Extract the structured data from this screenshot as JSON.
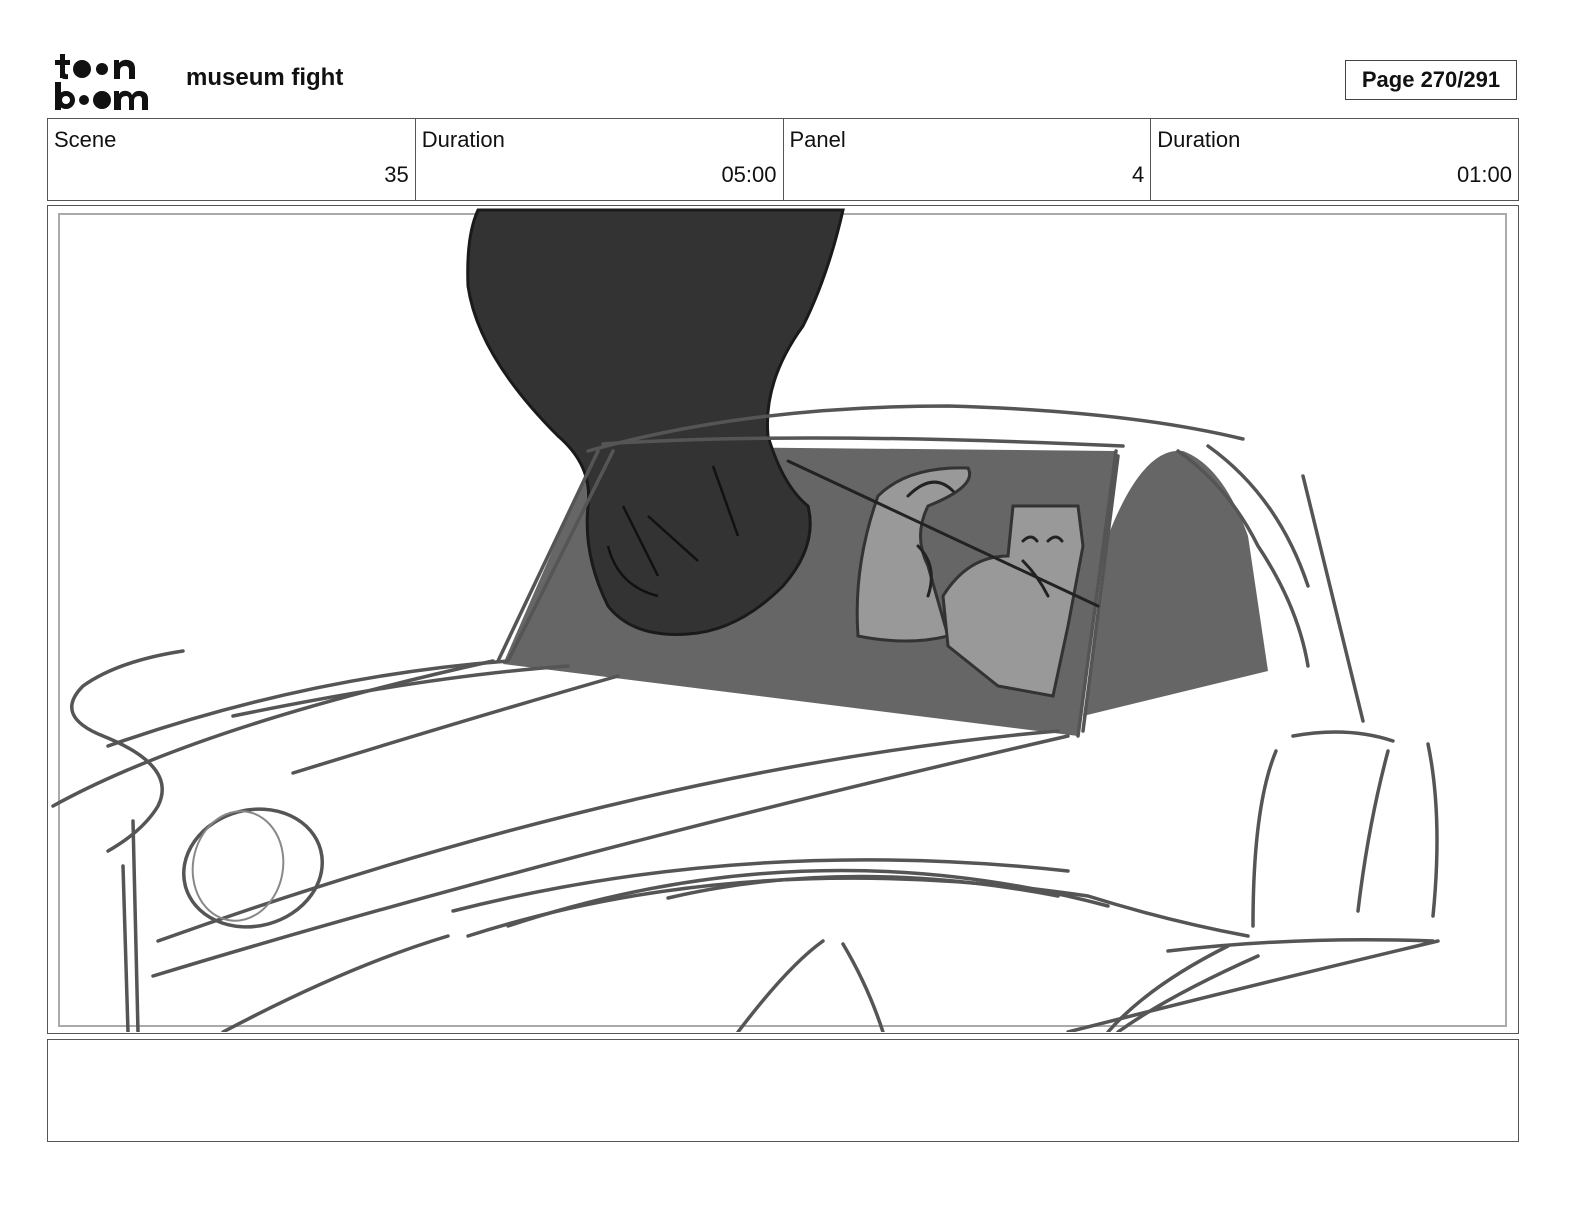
{
  "header": {
    "logo": {
      "name": "toonboom-logo",
      "line1": "toon",
      "line2": "boom"
    },
    "project_title": "museum fight",
    "page_label": "Page 270/291"
  },
  "info": [
    {
      "label": "Scene",
      "value": "35"
    },
    {
      "label": "Duration",
      "value": "05:00"
    },
    {
      "label": "Panel",
      "value": "4"
    },
    {
      "label": "Duration",
      "value": "01:00"
    }
  ],
  "panel": {
    "image": "storyboard-sketch",
    "description_visible": false
  },
  "notes": {
    "text": ""
  }
}
